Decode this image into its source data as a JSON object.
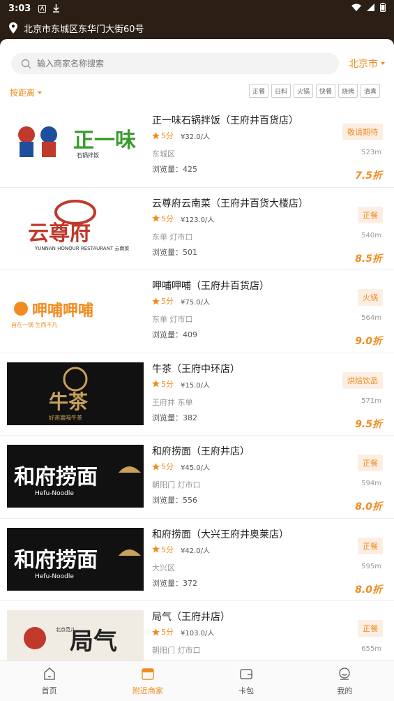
{
  "status": {
    "time": "3:03"
  },
  "location": {
    "address": "北京市东城区东华门大街60号"
  },
  "search": {
    "placeholder": "输入商家名称搜索",
    "city": "北京市"
  },
  "sort": {
    "label": "按距离"
  },
  "categories": [
    "正餐",
    "日料",
    "火锅",
    "快餐",
    "烧烤",
    "清真"
  ],
  "merchants": [
    {
      "name": "正一味石锅拌饭（王府井百货店）",
      "rating": "5分",
      "price": "¥32.0/人",
      "area": "东城区",
      "views": "浏览量：425",
      "tag": "敬请期待",
      "distance": "523m",
      "discount": "7.5折",
      "logo_text": "正一味",
      "logo_sub": "石锅拌饭"
    },
    {
      "name": "云尊府云南菜（王府井百货大楼店）",
      "rating": "5分",
      "price": "¥123.0/人",
      "area": "东单 灯市口",
      "views": "浏览量：501",
      "tag": "正餐",
      "distance": "540m",
      "discount": "8.5折",
      "logo_text": "云尊府",
      "logo_sub": "YUNNAN HONOUR RESTAURANT 云南菜"
    },
    {
      "name": "呷哺呷哺（王府井百货店）",
      "rating": "5分",
      "price": "¥75.0/人",
      "area": "东单 灯市口",
      "views": "浏览量：409",
      "tag": "火锅",
      "distance": "564m",
      "discount": "9.0折",
      "logo_text": "呷哺呷哺",
      "logo_sub": "自在一锅 生而不凡"
    },
    {
      "name": "牛茶（王府中环店）",
      "rating": "5分",
      "price": "¥15.0/人",
      "area": "王府井 东单",
      "views": "浏览量：382",
      "tag": "烘焙饮品",
      "distance": "571m",
      "discount": "9.5折",
      "logo_text": "牛茶",
      "logo_sub": "好燕窝喝牛茶"
    },
    {
      "name": "和府捞面（王府井店）",
      "rating": "5分",
      "price": "¥45.0/人",
      "area": "朝阳门 灯市口",
      "views": "浏览量：556",
      "tag": "正餐",
      "distance": "594m",
      "discount": "8.0折",
      "logo_text": "和府捞面",
      "logo_sub": "Hefu-Noodle"
    },
    {
      "name": "和府捞面（大兴王府井奥莱店）",
      "rating": "5分",
      "price": "¥42.0/人",
      "area": "大兴区",
      "views": "浏览量：372",
      "tag": "正餐",
      "distance": "595m",
      "discount": "8.0折",
      "logo_text": "和府捞面",
      "logo_sub": "Hefu-Noodle"
    },
    {
      "name": "局气（王府井店）",
      "rating": "5分",
      "price": "¥103.0/人",
      "area": "朝阳门 灯市口",
      "views": "",
      "tag": "正餐",
      "distance": "655m",
      "discount": "",
      "logo_text": "局气",
      "logo_sub": "北京范儿"
    }
  ],
  "tabbar": [
    {
      "label": "首页",
      "icon": "home-icon"
    },
    {
      "label": "附近商家",
      "icon": "shop-icon"
    },
    {
      "label": "卡包",
      "icon": "wallet-icon"
    },
    {
      "label": "我的",
      "icon": "user-icon"
    }
  ],
  "colors": {
    "accent": "#f08c1f",
    "header": "#2b1e15"
  }
}
